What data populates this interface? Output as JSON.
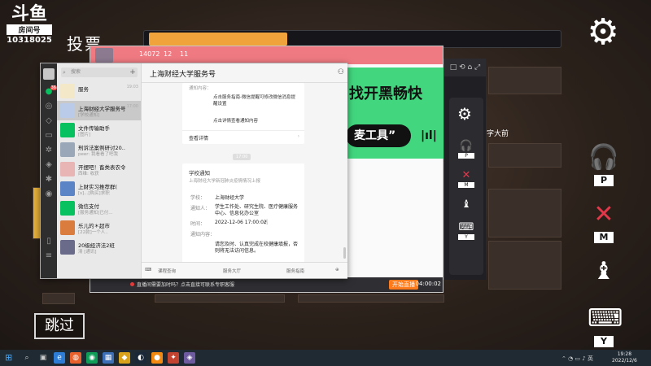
{
  "stream": {
    "platform_logo": "斗鱼",
    "room_label": "房间号",
    "room_id": "10318025"
  },
  "game": {
    "vote_title": "投票",
    "vote_progress": 0.34,
    "skip_label": "跳过",
    "side_label": "字大前",
    "keybinds": [
      {
        "name": "headphones-icon",
        "key": "P"
      },
      {
        "name": "mic-muted-icon",
        "key": "M"
      },
      {
        "name": "chess-piece-icon",
        "key": ""
      },
      {
        "name": "keyboard-icon",
        "key": "Y"
      }
    ]
  },
  "browser": {
    "stats": [
      "14072",
      "12",
      "11"
    ],
    "banner_line1": "找开黑畅快",
    "banner_pill": "麦工具”",
    "bottom_msg": "直播间需要加时吗？点击直接可联系专职客服",
    "live_label": "开始直播",
    "clock": "04:00:02"
  },
  "wechat": {
    "search_placeholder": "搜索",
    "header_title": "上海财经大学服务号",
    "chats": [
      {
        "name": "服务",
        "preview": "",
        "time": "19:03"
      },
      {
        "name": "上海财经大学服务号",
        "preview": "[学校通知]",
        "time": "17:00",
        "selected": true
      },
      {
        "name": "文件传输助手",
        "preview": "[图片]",
        "time": ""
      },
      {
        "name": "刑诉法案例研讨20...",
        "preview": "peer: 我看看了吧我",
        "time": ""
      },
      {
        "name": "开摆吧！畜类表农令",
        "preview": "西维: 收获",
        "time": ""
      },
      {
        "name": "上财实习推荐群(",
        "preview": "[s]...[购买]求职",
        "time": ""
      },
      {
        "name": "微信支付",
        "preview": "[服务通知]已付...",
        "time": ""
      },
      {
        "name": "乐儿的＊超市",
        "preview": "[22款]一个人..",
        "time": ""
      },
      {
        "name": "20级经济法2班",
        "preview": "清 [通讯]",
        "time": ""
      }
    ],
    "card1": {
      "line0": "通知内容：",
      "line1": "点击服务指南-微信提醒可修改微信消息提醒设置",
      "line2": "点击详情查看通知内容",
      "details": "查看详情"
    },
    "timestamp": "17:00",
    "card2": {
      "title": "学校通知",
      "subtitle": "上海财经大学新冠肺炎疫情情况上报",
      "school_label": "学校：",
      "school_value": "上海财经大学",
      "recipients_label": "通知人：",
      "recipients_value": "学生工作处、研究生院、医疗健康服务中心、信息化办公室",
      "time_label": "时间：",
      "time_value": "2022-12-06 17:00:02",
      "content_label": "通知内容：",
      "content_value": "请您及时、认真完成在校健康填报，否则将无法访问信息。"
    },
    "menu": [
      "课程查询",
      "服务大厅",
      "服务指南"
    ]
  },
  "taskbar": {
    "time": "19:28",
    "date": "2022/12/6"
  }
}
